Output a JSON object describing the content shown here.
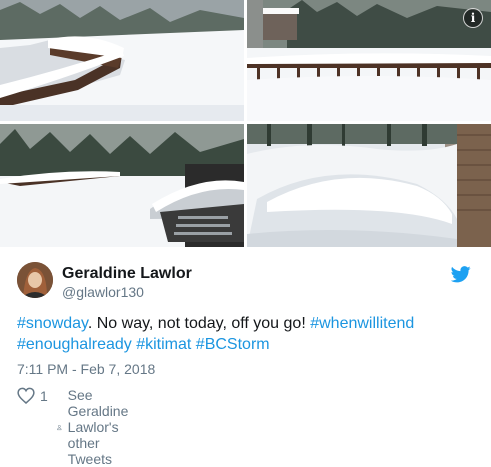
{
  "tweet": {
    "photos": [
      {
        "alt": "snow covered deck railing"
      },
      {
        "alt": "snow on deck and shed"
      },
      {
        "alt": "snow covered deck and trees"
      },
      {
        "alt": "snow drifts in yard"
      }
    ],
    "info_icon": "i",
    "author": {
      "name": "Geraldine Lawlor",
      "handle": "@glawlor130"
    },
    "text": {
      "tag1": "#snowday",
      "plain1": ". No way, not today, off you go! ",
      "tag2": "#whenwillitend",
      "tag3": "#enoughalready",
      "tag4": "#kitimat",
      "tag5": "#BCStorm"
    },
    "timestamp": "7:11 PM - Feb 7, 2018",
    "likes": "1",
    "profile_link": "See Geraldine Lawlor's other Tweets",
    "colors": {
      "link": "#1b95e0",
      "muted": "#657786",
      "twitter": "#1da1f2"
    },
    "icons": [
      "info-icon",
      "twitter-bird-icon",
      "heart-icon",
      "person-icon"
    ]
  }
}
